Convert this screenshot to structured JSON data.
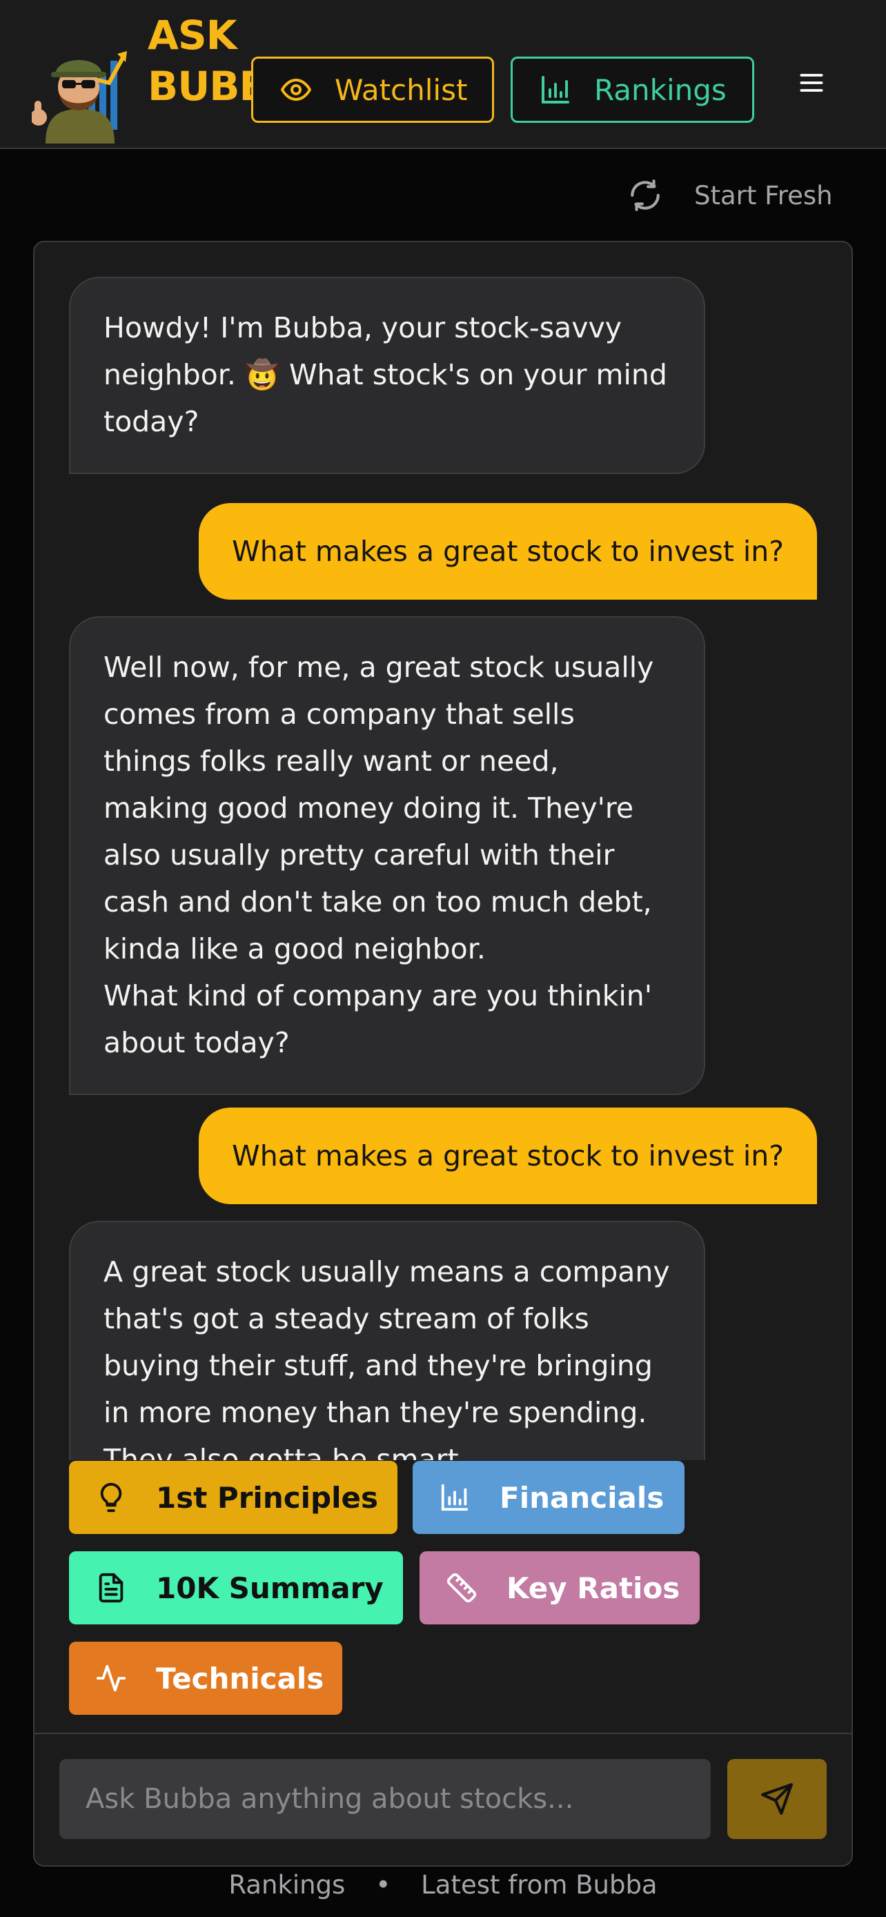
{
  "header": {
    "brand_line1": "ASK",
    "brand_line2": "BUBBA",
    "watchlist_label": "Watchlist",
    "rankings_label": "Rankings"
  },
  "toolbar": {
    "start_fresh_label": "Start Fresh"
  },
  "messages": [
    {
      "role": "bot",
      "text": "Howdy! I'm Bubba, your stock-savvy neighbor. 🤠 What stock's on your mind today?"
    },
    {
      "role": "user",
      "text": "What makes a great stock to invest in?"
    },
    {
      "role": "bot",
      "text": "Well now, for me, a great stock usually comes from a company that sells things folks really want or need, making good money doing it. They're also usually pretty careful with their cash and don't take on too much debt, kinda like a good neighbor.",
      "text2": "What kind of company are you thinkin' about today?"
    },
    {
      "role": "user",
      "text": "What makes a great stock to invest in?"
    },
    {
      "role": "bot",
      "text": "A great stock usually means a company that's got a steady stream of folks buying their stuff, and they're bringing in more money than they're spending. They also gotta be smart"
    }
  ],
  "quick_actions": {
    "principles": "1st Principles",
    "financials": "Financials",
    "summary_10k": "10K Summary",
    "key_ratios": "Key Ratios",
    "technicals": "Technicals"
  },
  "composer": {
    "placeholder": "Ask Bubba anything about stocks..."
  },
  "footer": {
    "rankings": "Rankings",
    "separator": "•",
    "latest": "Latest from Bubba"
  },
  "colors": {
    "accent_yellow": "#fbb80d",
    "accent_green": "#3ecf9a",
    "background": "#060607",
    "panel": "#1b1b1c"
  }
}
